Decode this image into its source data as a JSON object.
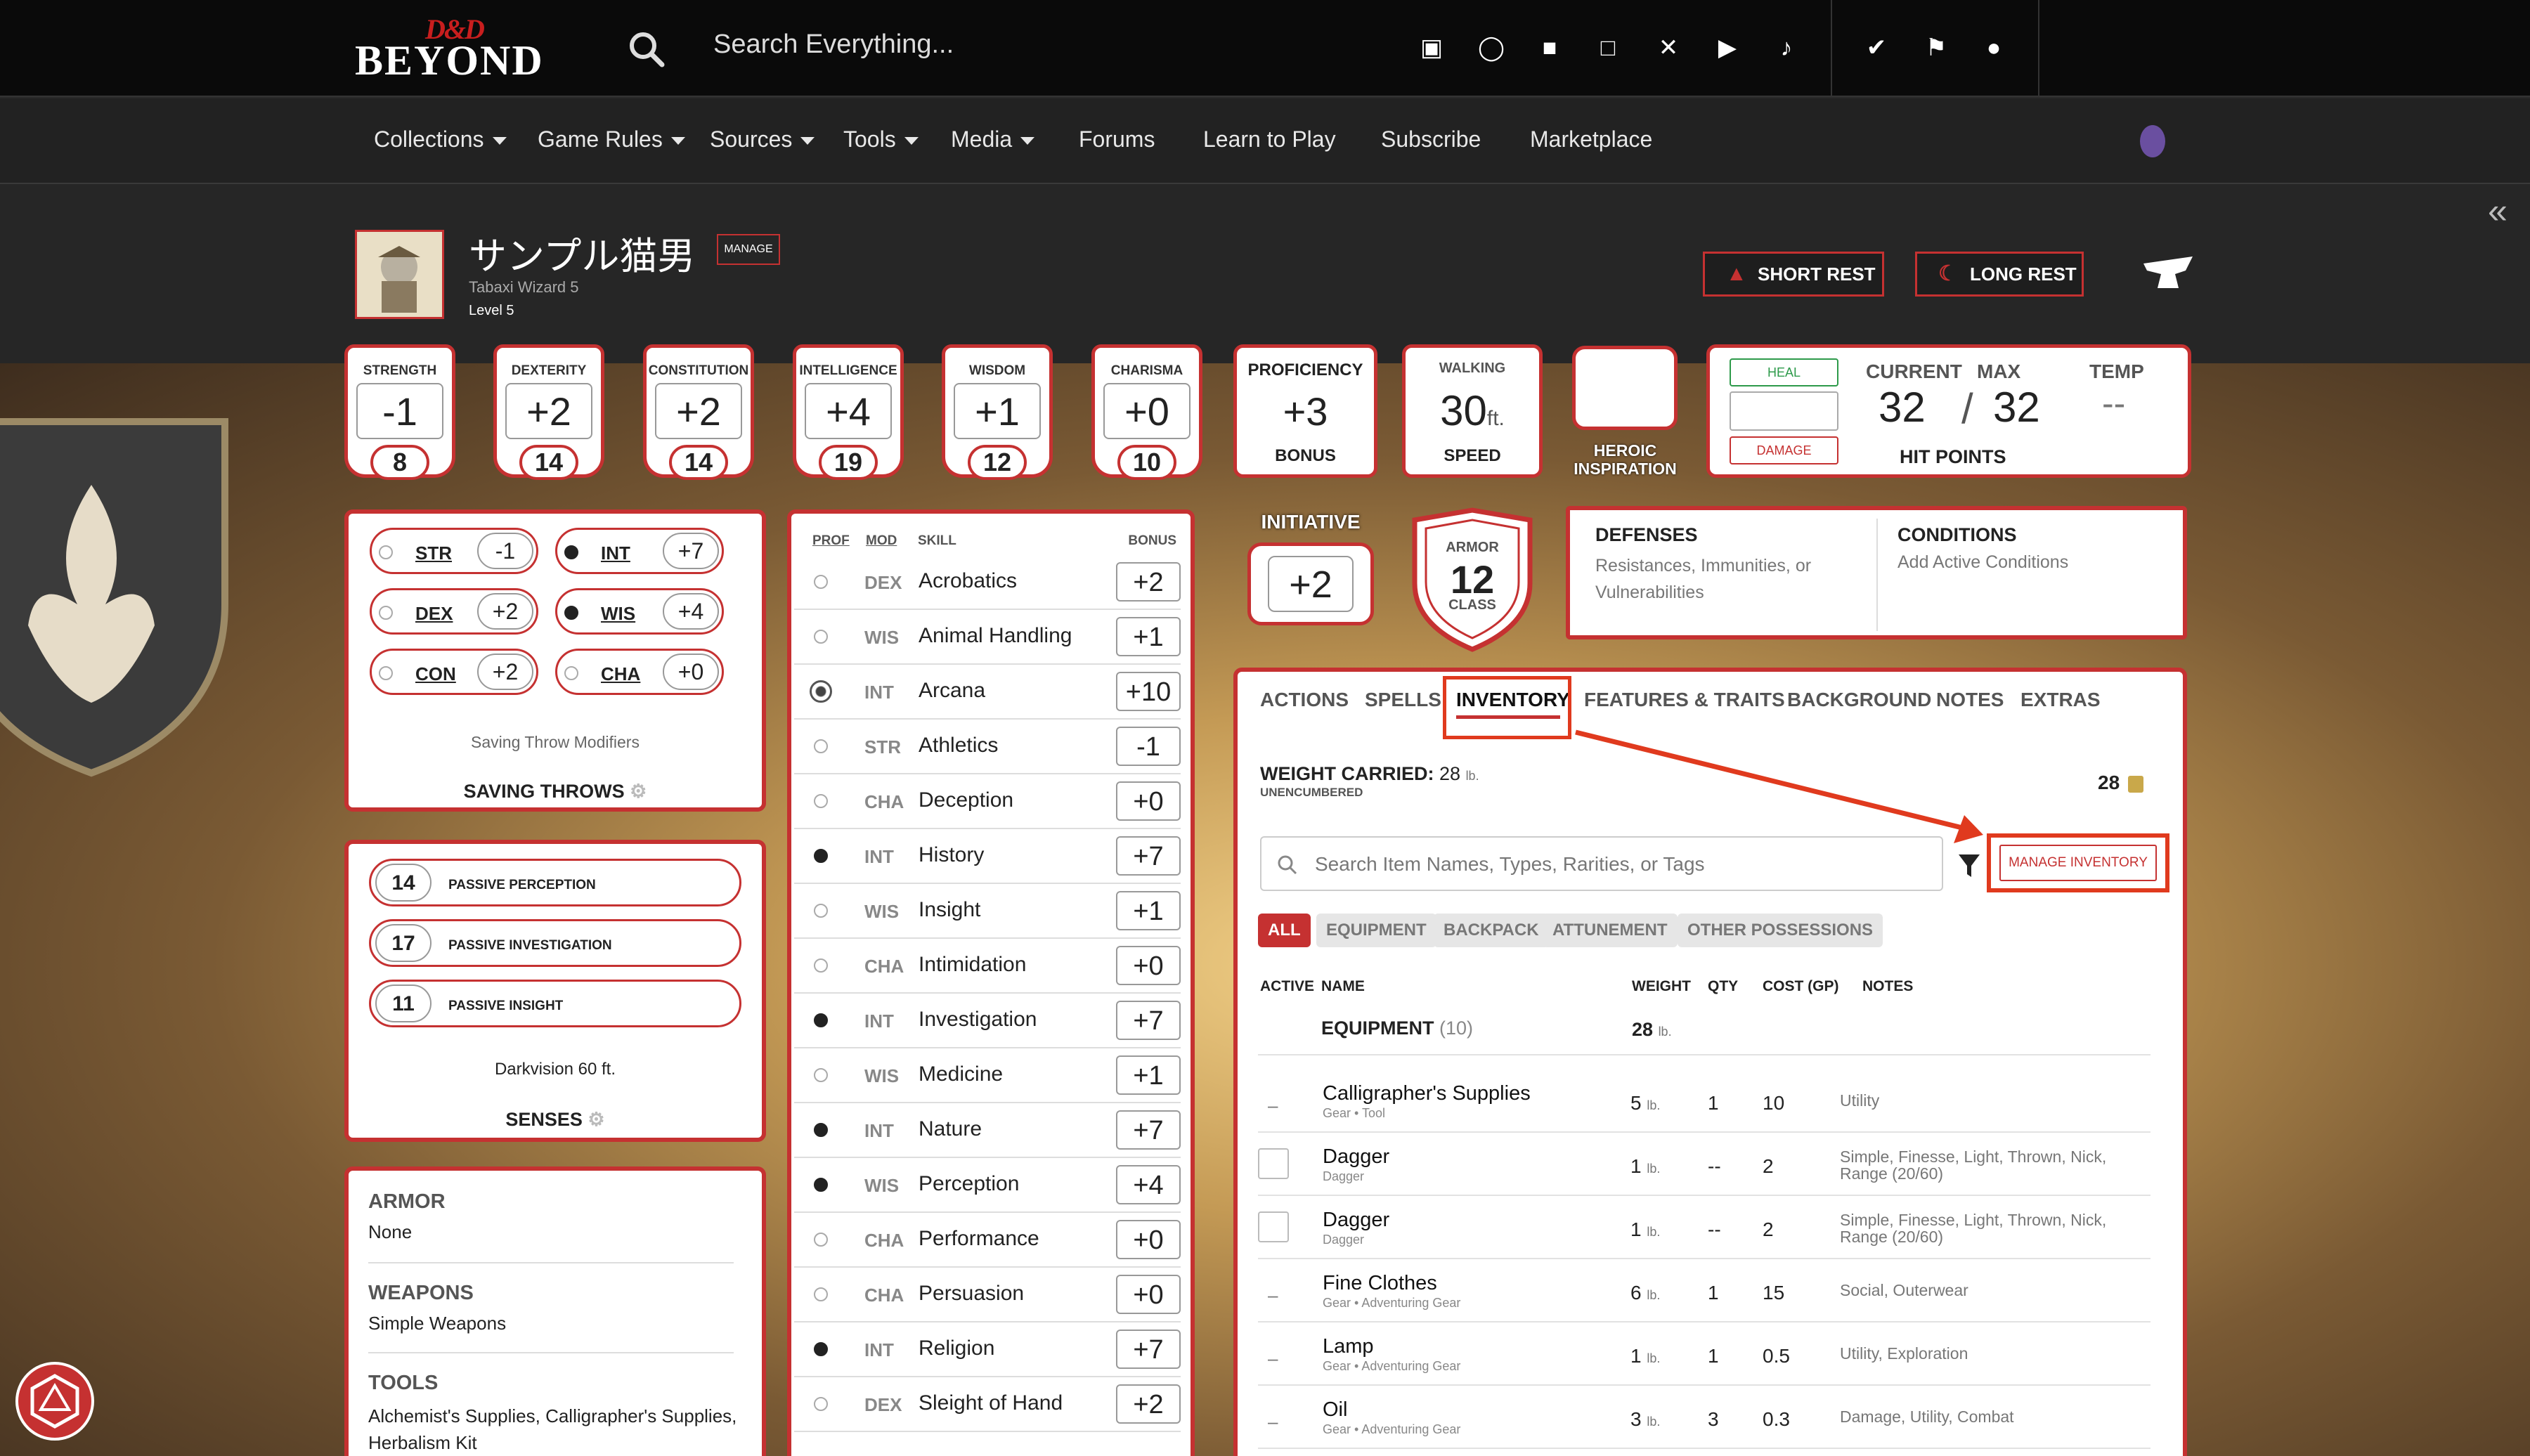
{
  "brand": {
    "logo_top": "D&D",
    "logo_bottom": "BEYOND"
  },
  "search": {
    "placeholder": "Search Everything..."
  },
  "social_icons": [
    "discord-icon",
    "instagram-icon",
    "facebook-icon",
    "twitch-icon",
    "x-icon",
    "youtube-icon",
    "tiktok-icon"
  ],
  "nav": {
    "items": [
      {
        "label": "Collections",
        "dropdown": true
      },
      {
        "label": "Game Rules",
        "dropdown": true
      },
      {
        "label": "Sources",
        "dropdown": true
      },
      {
        "label": "Tools",
        "dropdown": true
      },
      {
        "label": "Media",
        "dropdown": true
      },
      {
        "label": "Forums",
        "dropdown": false
      },
      {
        "label": "Learn to Play",
        "dropdown": false
      },
      {
        "label": "Subscribe",
        "dropdown": false
      },
      {
        "label": "Marketplace",
        "dropdown": false
      }
    ]
  },
  "character": {
    "name": "サンプル猫男",
    "manage": "MANAGE",
    "subtitle": "Tabaxi  Wizard 5",
    "level": "Level 5"
  },
  "header_buttons": {
    "short_rest": "SHORT REST",
    "long_rest": "LONG REST"
  },
  "abilities": [
    {
      "label": "STRENGTH",
      "mod": "-1",
      "score": "8"
    },
    {
      "label": "DEXTERITY",
      "mod": "+2",
      "score": "14"
    },
    {
      "label": "CONSTITUTION",
      "mod": "+2",
      "score": "14"
    },
    {
      "label": "INTELLIGENCE",
      "mod": "+4",
      "score": "19"
    },
    {
      "label": "WISDOM",
      "mod": "+1",
      "score": "12"
    },
    {
      "label": "CHARISMA",
      "mod": "+0",
      "score": "10"
    }
  ],
  "proficiency": {
    "top": "PROFICIENCY",
    "value": "+3",
    "bottom": "BONUS"
  },
  "speed": {
    "top": "WALKING",
    "value": "30",
    "unit": "ft.",
    "bottom": "SPEED"
  },
  "heroic_inspiration": "HEROIC INSPIRATION",
  "hit_points": {
    "heal": "HEAL",
    "damage": "DAMAGE",
    "current_label": "CURRENT",
    "max_label": "MAX",
    "temp_label": "TEMP",
    "current": "32",
    "slash": "/",
    "max": "32",
    "temp": "--",
    "label": "HIT POINTS"
  },
  "initiative": {
    "label": "INITIATIVE",
    "value": "+2"
  },
  "armor_class": {
    "top": "ARMOR",
    "value": "12",
    "bottom": "CLASS"
  },
  "defenses": {
    "title": "DEFENSES",
    "desc": "Resistances, Immunities, or Vulnerabilities"
  },
  "conditions": {
    "title": "CONDITIONS",
    "desc": "Add Active Conditions"
  },
  "saving_throws": {
    "items": [
      {
        "ab": "STR",
        "val": "-1",
        "prof": false
      },
      {
        "ab": "INT",
        "val": "+7",
        "prof": true
      },
      {
        "ab": "DEX",
        "val": "+2",
        "prof": false
      },
      {
        "ab": "WIS",
        "val": "+4",
        "prof": true
      },
      {
        "ab": "CON",
        "val": "+2",
        "prof": false
      },
      {
        "ab": "CHA",
        "val": "+0",
        "prof": false
      }
    ],
    "modifiers": "Saving Throw Modifiers",
    "title": "SAVING THROWS"
  },
  "senses": {
    "items": [
      {
        "val": "14",
        "label": "PASSIVE PERCEPTION"
      },
      {
        "val": "17",
        "label": "PASSIVE INVESTIGATION"
      },
      {
        "val": "11",
        "label": "PASSIVE INSIGHT"
      }
    ],
    "darkvision": "Darkvision 60 ft.",
    "title": "SENSES"
  },
  "proficiencies": {
    "armor_title": "ARMOR",
    "armor": "None",
    "weapons_title": "WEAPONS",
    "weapons": "Simple Weapons",
    "tools_title": "TOOLS",
    "tools": "Alchemist's Supplies, Calligrapher's Supplies, Herbalism Kit"
  },
  "skills": {
    "headers": {
      "prof": "PROF",
      "mod": "MOD",
      "skill": "SKILL",
      "bonus": "BONUS"
    },
    "items": [
      {
        "prof": "none",
        "mod": "DEX",
        "name": "Acrobatics",
        "bonus": "+2"
      },
      {
        "prof": "none",
        "mod": "WIS",
        "name": "Animal Handling",
        "bonus": "+1"
      },
      {
        "prof": "expert",
        "mod": "INT",
        "name": "Arcana",
        "bonus": "+10"
      },
      {
        "prof": "none",
        "mod": "STR",
        "name": "Athletics",
        "bonus": "-1"
      },
      {
        "prof": "none",
        "mod": "CHA",
        "name": "Deception",
        "bonus": "+0"
      },
      {
        "prof": "prof",
        "mod": "INT",
        "name": "History",
        "bonus": "+7"
      },
      {
        "prof": "none",
        "mod": "WIS",
        "name": "Insight",
        "bonus": "+1"
      },
      {
        "prof": "none",
        "mod": "CHA",
        "name": "Intimidation",
        "bonus": "+0"
      },
      {
        "prof": "prof",
        "mod": "INT",
        "name": "Investigation",
        "bonus": "+7"
      },
      {
        "prof": "none",
        "mod": "WIS",
        "name": "Medicine",
        "bonus": "+1"
      },
      {
        "prof": "prof",
        "mod": "INT",
        "name": "Nature",
        "bonus": "+7"
      },
      {
        "prof": "prof",
        "mod": "WIS",
        "name": "Perception",
        "bonus": "+4"
      },
      {
        "prof": "none",
        "mod": "CHA",
        "name": "Performance",
        "bonus": "+0"
      },
      {
        "prof": "none",
        "mod": "CHA",
        "name": "Persuasion",
        "bonus": "+0"
      },
      {
        "prof": "prof",
        "mod": "INT",
        "name": "Religion",
        "bonus": "+7"
      },
      {
        "prof": "none",
        "mod": "DEX",
        "name": "Sleight of Hand",
        "bonus": "+2"
      }
    ]
  },
  "tabs": [
    "ACTIONS",
    "SPELLS",
    "INVENTORY",
    "FEATURES & TRAITS",
    "BACKGROUND",
    "NOTES",
    "EXTRAS"
  ],
  "active_tab": "INVENTORY",
  "inventory": {
    "weight_label": "WEIGHT CARRIED:",
    "weight_value": "28",
    "weight_unit": "lb.",
    "encumbrance": "UNENCUMBERED",
    "currency": "28",
    "search_placeholder": "Search Item Names, Types, Rarities, or Tags",
    "manage_button": "MANAGE INVENTORY",
    "filters": [
      "ALL",
      "EQUIPMENT",
      "BACKPACK",
      "ATTUNEMENT",
      "OTHER POSSESSIONS"
    ],
    "columns": {
      "active": "ACTIVE",
      "name": "NAME",
      "weight": "WEIGHT",
      "qty": "QTY",
      "cost": "COST (GP)",
      "notes": "NOTES"
    },
    "group_label": "EQUIPMENT",
    "group_count": "(10)",
    "group_weight": "28",
    "lb": "lb.",
    "items": [
      {
        "active": "dash",
        "name": "Calligrapher's Supplies",
        "sub": "Gear • Tool",
        "weight": "5",
        "qty": "1",
        "cost": "10",
        "notes": "Utility"
      },
      {
        "active": "box",
        "name": "Dagger",
        "sub": "Dagger",
        "weight": "1",
        "qty": "--",
        "cost": "2",
        "notes": "Simple, Finesse, Light, Thrown, Nick, Range (20/60)"
      },
      {
        "active": "box",
        "name": "Dagger",
        "sub": "Dagger",
        "weight": "1",
        "qty": "--",
        "cost": "2",
        "notes": "Simple, Finesse, Light, Thrown, Nick, Range (20/60)"
      },
      {
        "active": "dash",
        "name": "Fine Clothes",
        "sub": "Gear • Adventuring Gear",
        "weight": "6",
        "qty": "1",
        "cost": "15",
        "notes": "Social, Outerwear"
      },
      {
        "active": "dash",
        "name": "Lamp",
        "sub": "Gear • Adventuring Gear",
        "weight": "1",
        "qty": "1",
        "cost": "0.5",
        "notes": "Utility, Exploration"
      },
      {
        "active": "dash",
        "name": "Oil",
        "sub": "Gear • Adventuring Gear",
        "weight": "3",
        "qty": "3",
        "cost": "0.3",
        "notes": "Damage, Utility, Combat"
      }
    ]
  },
  "colors": {
    "accent": "#c53131",
    "highlight": "#e03a1e",
    "dark": "#0a0a0a"
  }
}
